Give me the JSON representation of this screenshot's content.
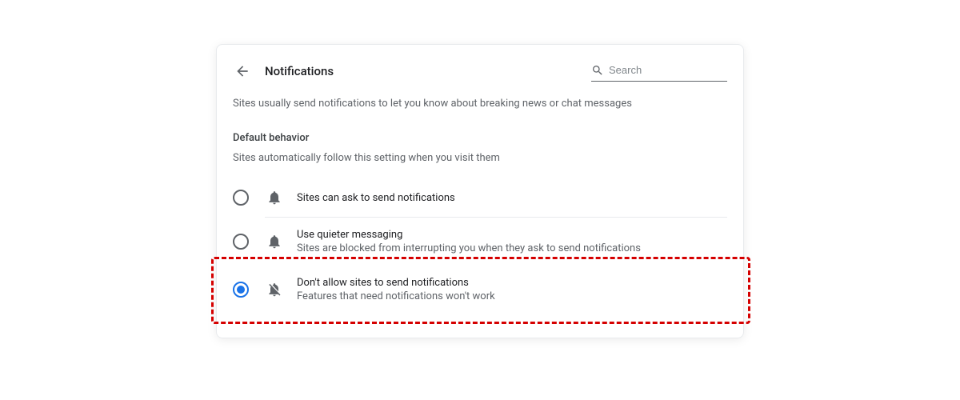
{
  "header": {
    "title": "Notifications",
    "search_placeholder": "Search"
  },
  "description": "Sites usually send notifications to let you know about breaking news or chat messages",
  "section": {
    "title": "Default behavior",
    "subtitle": "Sites automatically follow this setting when you visit them"
  },
  "options": [
    {
      "label": "Sites can ask to send notifications",
      "sub": ""
    },
    {
      "label": "Use quieter messaging",
      "sub": "Sites are blocked from interrupting you when they ask to send notifications"
    },
    {
      "label": "Don't allow sites to send notifications",
      "sub": "Features that need notifications won't work"
    }
  ]
}
